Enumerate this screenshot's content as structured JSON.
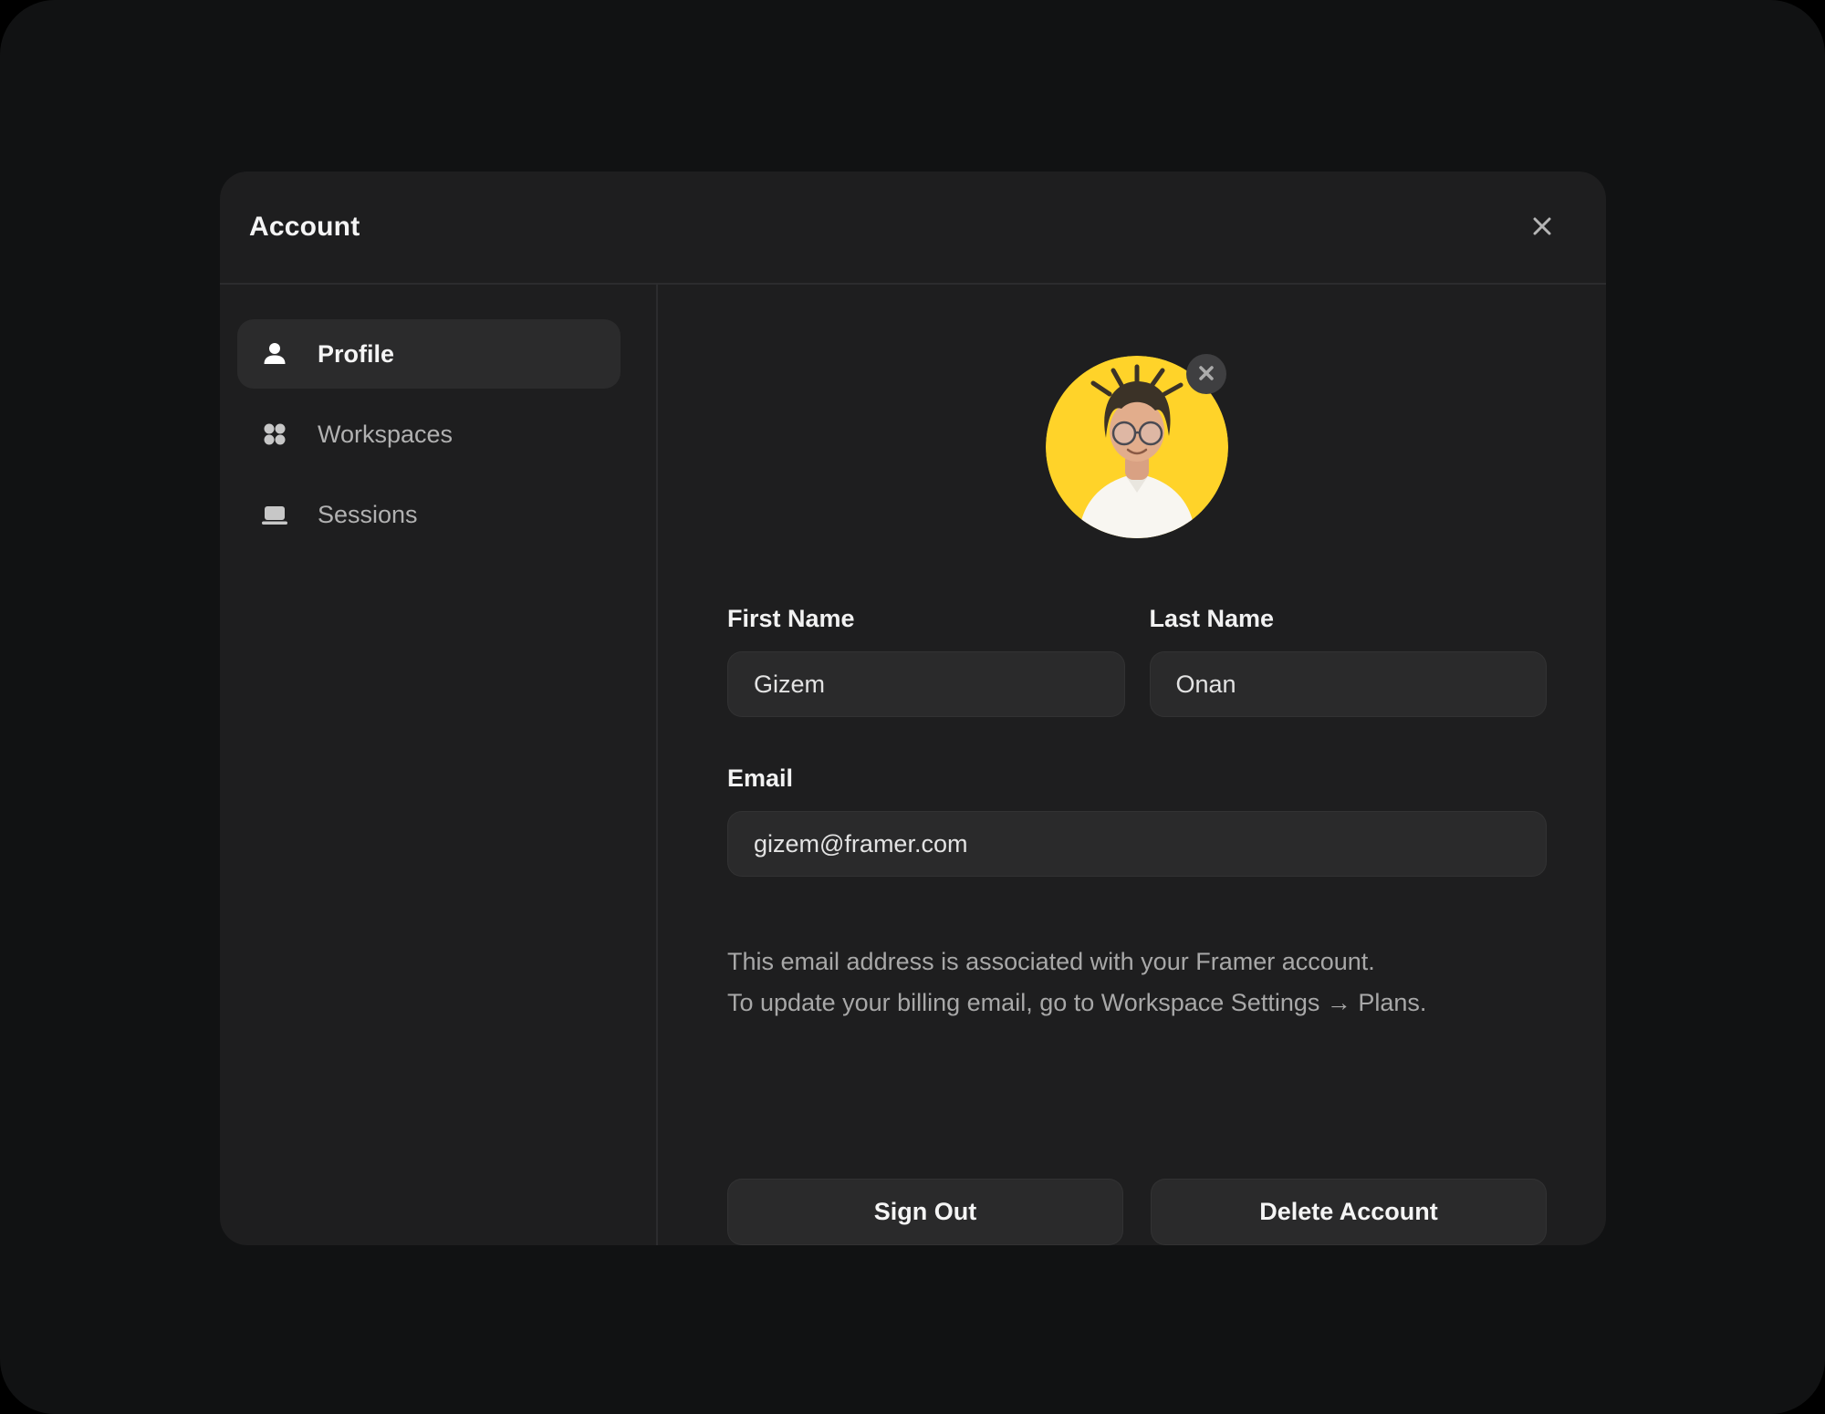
{
  "colors": {
    "page_bg": "#111213",
    "modal_bg": "#1e1e1f",
    "surface": "#2a2a2b",
    "divider": "#2c2c2e",
    "avatar_yellow": "#ffd329"
  },
  "header": {
    "title": "Account",
    "close_icon": "close-x"
  },
  "sidebar": {
    "items": [
      {
        "label": "Profile",
        "icon": "person-icon",
        "active": true
      },
      {
        "label": "Workspaces",
        "icon": "grid-icon",
        "active": false
      },
      {
        "label": "Sessions",
        "icon": "laptop-icon",
        "active": false
      }
    ]
  },
  "profile": {
    "avatar": {
      "description": "circular photo of person on yellow background",
      "remove_icon": "close-x"
    },
    "fields": {
      "first_name": {
        "label": "First Name",
        "value": "Gizem"
      },
      "last_name": {
        "label": "Last Name",
        "value": "Onan"
      },
      "email": {
        "label": "Email",
        "value": "gizem@framer.com"
      }
    },
    "email_note_line1": "This email address is associated with your Framer account.",
    "email_note_line2": "To update your billing email, go to Workspace Settings → Plans.",
    "actions": {
      "sign_out": "Sign Out",
      "delete_account": "Delete Account"
    }
  }
}
